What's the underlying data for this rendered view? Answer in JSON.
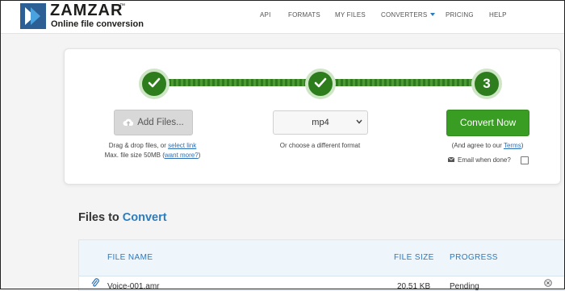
{
  "brand": {
    "name": "ZAMZAR",
    "trademark": "™",
    "tagline": "Online file conversion"
  },
  "nav": [
    {
      "label": "API"
    },
    {
      "label": "FORMATS"
    },
    {
      "label": "MY FILES"
    },
    {
      "label": "CONVERTERS"
    },
    {
      "label": "PRICING"
    },
    {
      "label": "HELP"
    }
  ],
  "steps": {
    "step1_icon": "checkmark",
    "step2_icon": "checkmark",
    "step3_label": "3"
  },
  "step1": {
    "button": "Add Files...",
    "hint_line1": "Drag & drop files, or",
    "hint_link1": "select link",
    "hint_line2": "Max. file size 50MB (",
    "hint_link2": "want more?",
    "hint_end": ")"
  },
  "step2": {
    "selected_format": "mp4",
    "hint": "Or choose a different format"
  },
  "step3": {
    "button": "Convert Now",
    "agree_text": "(And agree to our",
    "terms_link": "Terms",
    "agree_end": ")",
    "email_label": "Email when done?"
  },
  "files": {
    "title_plain": "Files to",
    "title_accent": "Convert",
    "columns": {
      "name": "FILE NAME",
      "size": "FILE SIZE",
      "progress": "PROGRESS"
    },
    "rows": [
      {
        "name": "Voice-001.amr",
        "size": "20.51 KB",
        "progress": "Pending"
      }
    ]
  },
  "colors": {
    "accent": "#2c7cbe",
    "green": "#3a9d23",
    "step_green": "#2e7d1d"
  },
  "icons": [
    "logo-mark",
    "check-icon",
    "cloud-upload-icon",
    "chevron-down-icon",
    "mail-icon",
    "paperclip-icon",
    "remove-circle-icon"
  ]
}
